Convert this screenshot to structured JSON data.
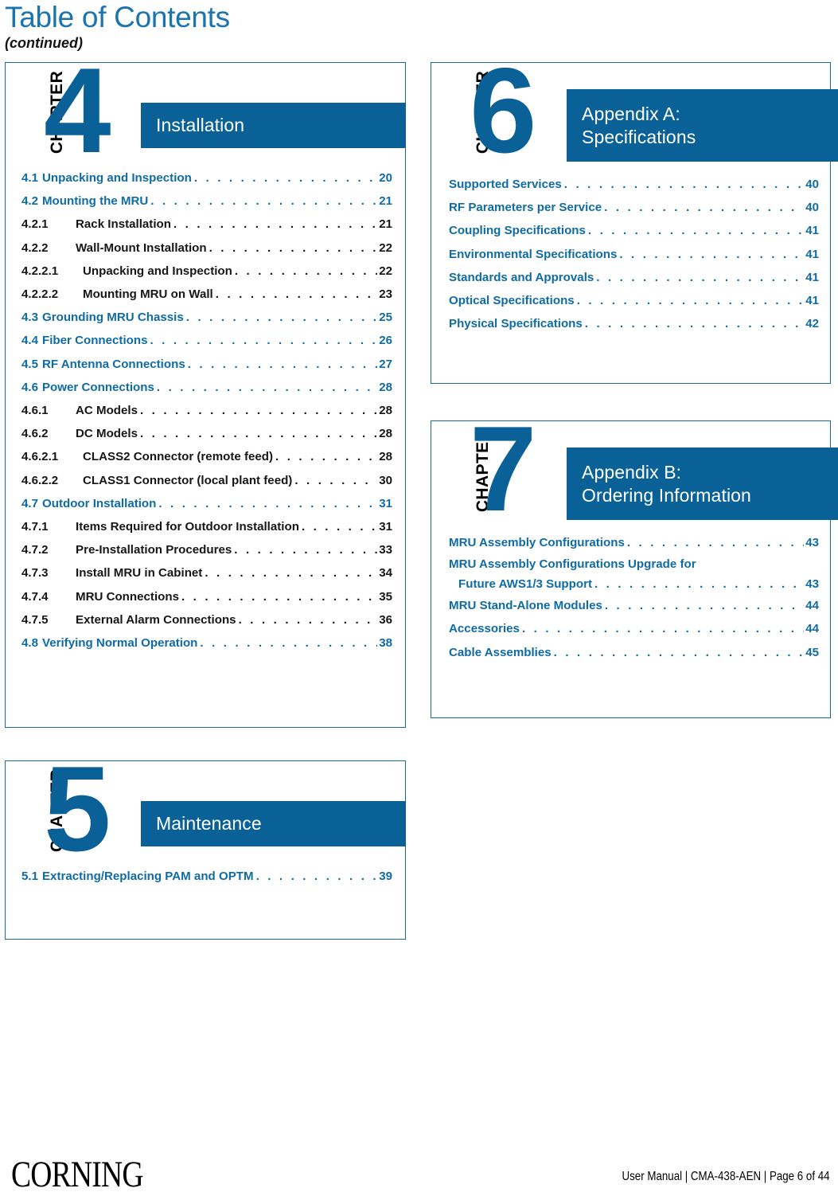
{
  "header": {
    "title": "Table of Contents",
    "subtitle": "(continued)"
  },
  "colors": {
    "accent_blue": "#0a6198",
    "title_blue": "#1a74b0",
    "entry_blue": "#0f6ba5",
    "entry_black": "#161616",
    "box_border": "#1a6b9c"
  },
  "chapters": [
    {
      "chapter_word": "CHAPTER",
      "number": "4",
      "title_lines": [
        "Installation"
      ],
      "entries": [
        {
          "level": 1,
          "num": "4.1",
          "label": "Unpacking and Inspection",
          "page": "20"
        },
        {
          "level": 1,
          "num": "4.2",
          "label": "Mounting the MRU",
          "page": "21"
        },
        {
          "level": 2,
          "num": "4.2.1",
          "label": "Rack Installation",
          "page": "21"
        },
        {
          "level": 2,
          "num": "4.2.2",
          "label": "Wall-Mount Installation",
          "page": "22"
        },
        {
          "level": 3,
          "num": "4.2.2.1",
          "label": "Unpacking and Inspection",
          "page": "22"
        },
        {
          "level": 3,
          "num": "4.2.2.2",
          "label": "Mounting MRU on Wall",
          "page": "23"
        },
        {
          "level": 1,
          "num": "4.3",
          "label": "Grounding MRU Chassis",
          "page": "25"
        },
        {
          "level": 1,
          "num": "4.4",
          "label": "Fiber Connections",
          "page": "26"
        },
        {
          "level": 1,
          "num": "4.5",
          "label": "RF Antenna Connections",
          "page": "27"
        },
        {
          "level": 1,
          "num": "4.6",
          "label": "Power Connections",
          "page": "28"
        },
        {
          "level": 2,
          "num": "4.6.1",
          "label": "AC Models",
          "page": "28"
        },
        {
          "level": 2,
          "num": "4.6.2",
          "label": "DC Models",
          "page": "28"
        },
        {
          "level": 3,
          "num": "4.6.2.1",
          "label": "CLASS2 Connector (remote feed)",
          "page": "28"
        },
        {
          "level": 3,
          "num": "4.6.2.2",
          "label": "CLASS1 Connector (local plant feed)",
          "page": "30"
        },
        {
          "level": 1,
          "num": "4.7",
          "label": "Outdoor Installation",
          "page": "31"
        },
        {
          "level": 2,
          "num": "4.7.1",
          "label": "Items Required for Outdoor Installation",
          "page": "31"
        },
        {
          "level": 2,
          "num": "4.7.2",
          "label": "Pre-Installation Procedures",
          "page": "33"
        },
        {
          "level": 2,
          "num": "4.7.3",
          "label": "Install MRU in Cabinet",
          "page": "34"
        },
        {
          "level": 2,
          "num": "4.7.4",
          "label": "MRU Connections",
          "page": "35"
        },
        {
          "level": 2,
          "num": "4.7.5",
          "label": "External Alarm Connections",
          "page": "36"
        },
        {
          "level": 1,
          "num": "4.8",
          "label": "Verifying Normal Operation",
          "page": "38"
        }
      ]
    },
    {
      "chapter_word": "CHAPTER",
      "number": "5",
      "title_lines": [
        "Maintenance"
      ],
      "entries": [
        {
          "level": 1,
          "num": "5.1",
          "label": "Extracting/Replacing PAM and OPTM",
          "page": "39"
        }
      ]
    },
    {
      "chapter_word": "CHAPTER",
      "number": "6",
      "title_lines": [
        "Appendix A:",
        "Specifications"
      ],
      "entries": [
        {
          "level": 0,
          "num": "",
          "label": "Supported Services",
          "page": "40"
        },
        {
          "level": 0,
          "num": "",
          "label": "RF Parameters per Service",
          "page": "40"
        },
        {
          "level": 0,
          "num": "",
          "label": "Coupling Specifications",
          "page": "41"
        },
        {
          "level": 0,
          "num": "",
          "label": "Environmental Specifications",
          "page": "41"
        },
        {
          "level": 0,
          "num": "",
          "label": "Standards and Approvals",
          "page": "41"
        },
        {
          "level": 0,
          "num": "",
          "label": "Optical Specifications",
          "page": "41"
        },
        {
          "level": 0,
          "num": "",
          "label": "Physical Specifications",
          "page": "42"
        }
      ]
    },
    {
      "chapter_word": "CHAPTER",
      "number": "7",
      "title_lines": [
        "Appendix B:",
        "Ordering Information"
      ],
      "entries": [
        {
          "level": 0,
          "num": "",
          "label": "MRU Assembly Configurations",
          "page": "43"
        },
        {
          "level": 0,
          "num": "",
          "label": "MRU Assembly Configurations Upgrade for",
          "wrap_label": "Future AWS1/3 Support",
          "page": "43"
        },
        {
          "level": 0,
          "num": "",
          "label": "MRU Stand-Alone Modules",
          "page": "44"
        },
        {
          "level": 0,
          "num": "",
          "label": "Accessories",
          "page": "44"
        },
        {
          "level": 0,
          "num": "",
          "label": "Cable Assemblies",
          "page": "45"
        }
      ]
    }
  ],
  "footer": {
    "logo": "CORNING",
    "meta": "User Manual | CMA-438-AEN | Page 6 of 44"
  }
}
